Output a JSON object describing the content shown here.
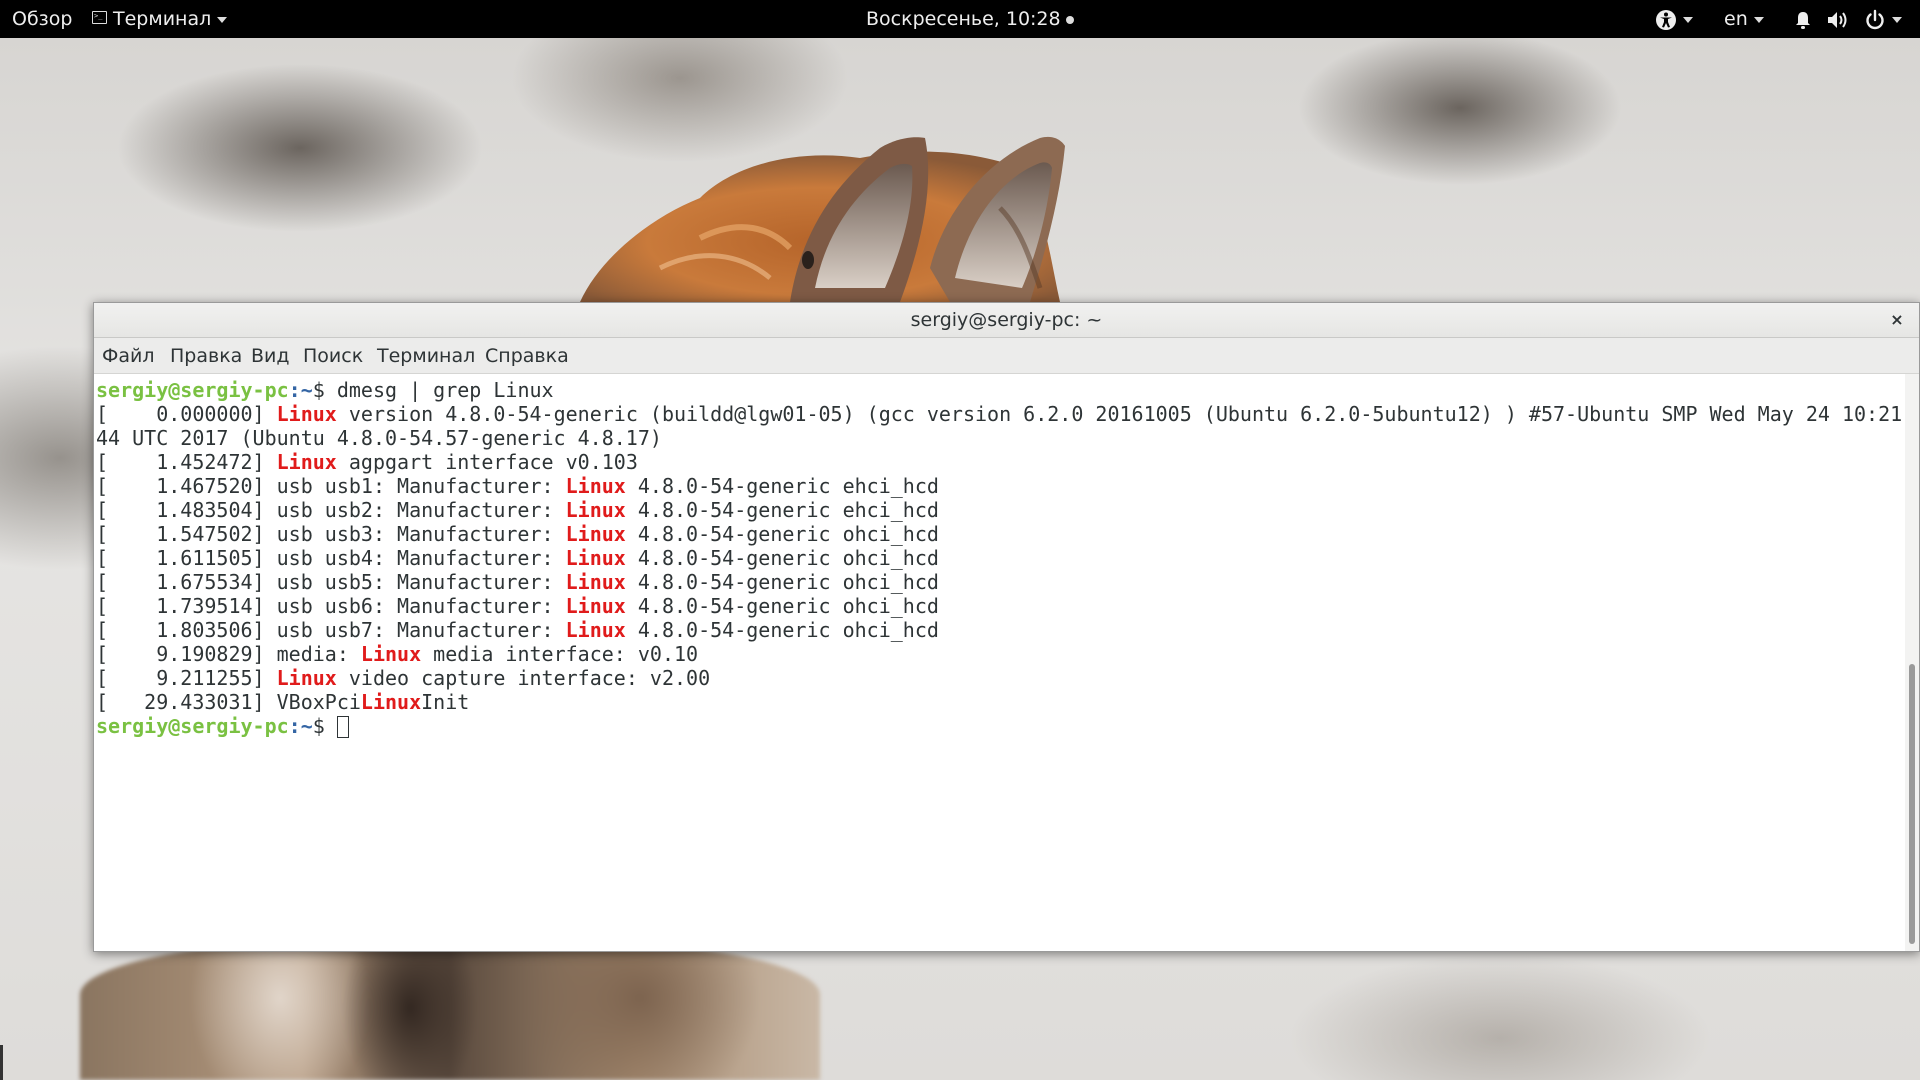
{
  "topbar": {
    "activities": "Обзор",
    "app_menu": "Терминал",
    "clock": "Воскресенье, 10:28",
    "language": "en",
    "tray_icons": [
      "accessibility-icon",
      "notifications-icon",
      "volume-icon",
      "power-icon"
    ]
  },
  "window": {
    "title": "sergiy@sergiy-pc: ~",
    "close_label": "×",
    "menu": [
      "Файл",
      "Правка",
      "Вид",
      "Поиск",
      "Терминал",
      "Справка"
    ]
  },
  "terminal": {
    "prompt_user": "sergiy@sergiy-pc",
    "prompt_path": ":~",
    "prompt_symbol": "$ ",
    "command": "dmesg | grep Linux",
    "highlight_color": "#e01b1b",
    "prompt_color": "#7ac142",
    "output_lines": [
      "[    0.000000] {{Linux}} version 4.8.0-54-generic (buildd@lgw01-05) (gcc version 6.2.0 20161005 (Ubuntu 6.2.0-5ubuntu12) ) #57-Ubuntu SMP Wed May 24 10:21:",
      "44 UTC 2017 (Ubuntu 4.8.0-54.57-generic 4.8.17)",
      "[    1.452472] {{Linux}} agpgart interface v0.103",
      "[    1.467520] usb usb1: Manufacturer: {{Linux}} 4.8.0-54-generic ehci_hcd",
      "[    1.483504] usb usb2: Manufacturer: {{Linux}} 4.8.0-54-generic ehci_hcd",
      "[    1.547502] usb usb3: Manufacturer: {{Linux}} 4.8.0-54-generic ohci_hcd",
      "[    1.611505] usb usb4: Manufacturer: {{Linux}} 4.8.0-54-generic ohci_hcd",
      "[    1.675534] usb usb5: Manufacturer: {{Linux}} 4.8.0-54-generic ohci_hcd",
      "[    1.739514] usb usb6: Manufacturer: {{Linux}} 4.8.0-54-generic ohci_hcd",
      "[    1.803506] usb usb7: Manufacturer: {{Linux}} 4.8.0-54-generic ohci_hcd",
      "[    9.190829] media: {{Linux}} media interface: v0.10",
      "[    9.211255] {{Linux}} video capture interface: v2.00",
      "[   29.433031] VBoxPci{{Linux}}Init"
    ]
  }
}
